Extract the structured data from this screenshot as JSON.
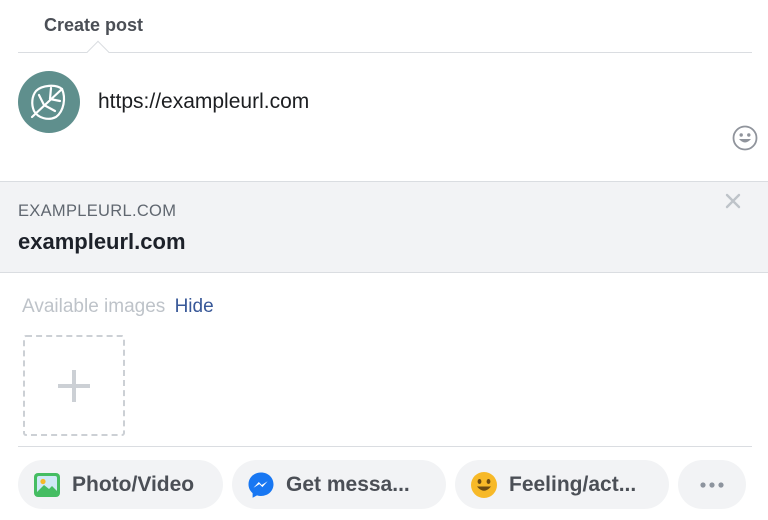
{
  "header": {
    "tab_label": "Create post"
  },
  "composer": {
    "text": "https://exampleurl.com",
    "avatar_icon": "leaf-avatar-icon",
    "emoji_icon": "smiley-icon"
  },
  "link_preview": {
    "domain": "EXAMPLEURL.COM",
    "title": "exampleurl.com",
    "close_icon": "close-icon"
  },
  "images": {
    "label": "Available images",
    "hide_label": "Hide",
    "add_icon": "plus-icon"
  },
  "actions": [
    {
      "label": "Photo/Video",
      "icon": "photo-icon"
    },
    {
      "label": "Get messa...",
      "icon": "messenger-icon"
    },
    {
      "label": "Feeling/act...",
      "icon": "smiley-icon"
    },
    {
      "label": "",
      "icon": "more-icon"
    }
  ],
  "colors": {
    "link": "#385898",
    "messenger": "#1877f2",
    "avatar_bg": "#5f8f8d",
    "pill_bg": "#f2f3f5"
  }
}
